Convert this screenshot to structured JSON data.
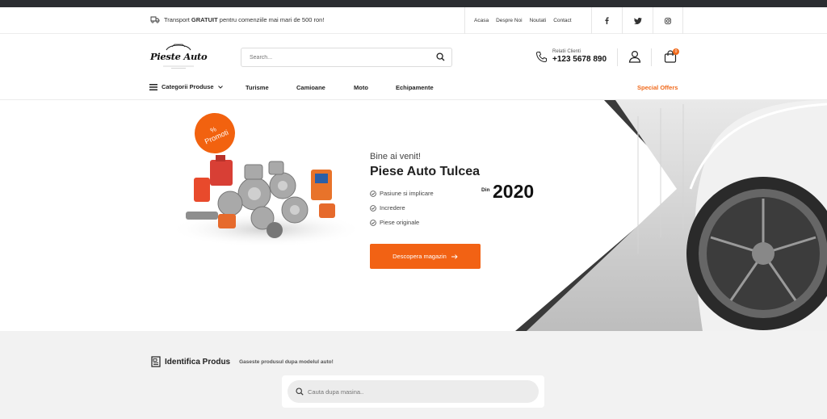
{
  "topbar": {
    "shipping_prefix": "Transport ",
    "shipping_bold": "GRATUIT",
    "shipping_suffix": " pentru comenziile mai mari de 500 ron!",
    "links": [
      "Acasa",
      "Despre Noi",
      "Noutati",
      "Contact"
    ],
    "socials": [
      "facebook-icon",
      "twitter-icon",
      "instagram-icon"
    ]
  },
  "header": {
    "logo_text": "Pieste Auto",
    "search_placeholder": "Search...",
    "support_label": "Relatii Clienti",
    "support_phone": "+123 5678 890",
    "cart_count": "0"
  },
  "nav": {
    "categories_label": "Categorii Produse",
    "items": [
      "Turisme",
      "Camioane",
      "Moto",
      "Echipamente"
    ],
    "special": "Special Offers"
  },
  "hero": {
    "promo_pct": "%",
    "promo_label": "Promoti",
    "welcome": "Bine ai venit!",
    "title": "Piese Auto Tulcea",
    "features": [
      "Pasiune si implicare",
      "Incredere",
      "Piese originale"
    ],
    "since_label": "Din",
    "since_year": "2020",
    "cta_label": "Descopera magazin",
    "accent_color": "#f26214"
  },
  "identify": {
    "title": "Identifica Produs",
    "subtitle": "Gaseste produsul dupa modelul auto!",
    "placeholder": "Cauta dupa masina.."
  }
}
